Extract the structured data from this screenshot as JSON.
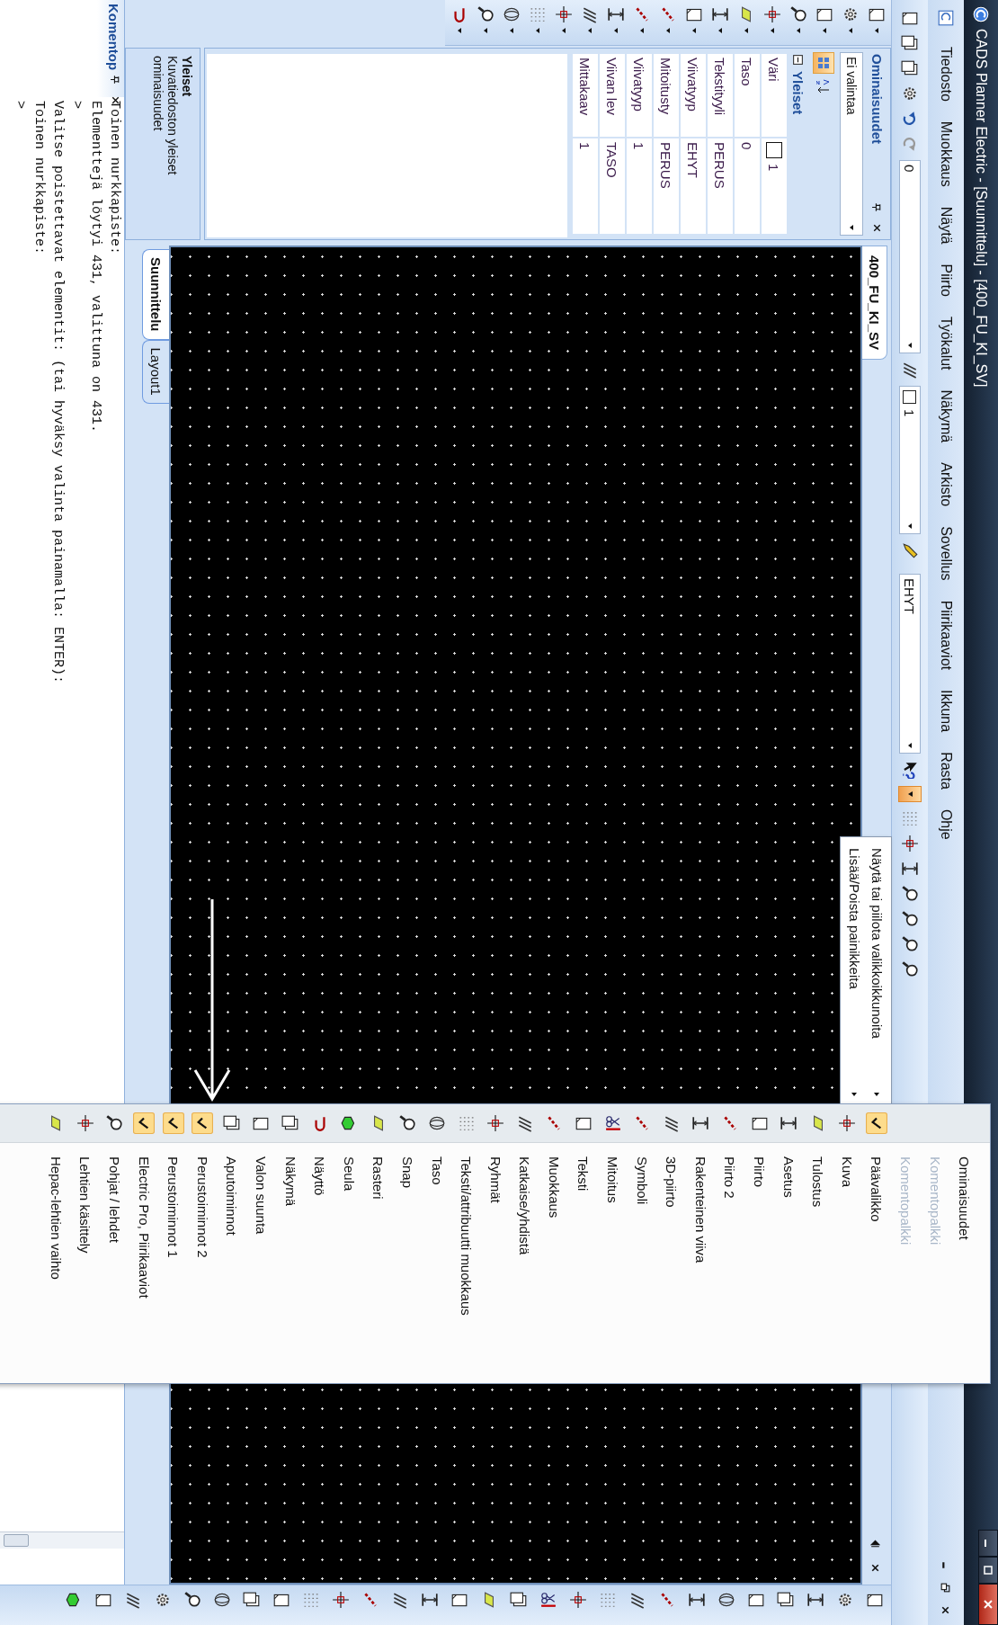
{
  "window": {
    "title": "CADS Planner Electric - [Suunnittelu] - [400_FU_KI_SV]"
  },
  "menu_bar": {
    "items": [
      "Tiedosto",
      "Muokkaus",
      "Näytä",
      "Piirto",
      "Työkalut",
      "Näkymä",
      "Arkisto",
      "Sovellus",
      "Piirikaaviot",
      "Ikkuna",
      "Rasta",
      "Ohje"
    ]
  },
  "toolbar": {
    "layer_combo": "0",
    "color_combo": "1",
    "linetype_combo": "EHYT",
    "overflow_button": {
      "expanded": true
    }
  },
  "properties_panel": {
    "title": "Ominaisuudet",
    "selection": "Ei valintaa",
    "sort_buttons": [
      {
        "kind": "categorized",
        "selected": true
      },
      {
        "kind": "alphabetical",
        "selected": false
      }
    ],
    "section": {
      "title": "Yleiset",
      "expanded": true
    },
    "rows": [
      {
        "kind": "color",
        "label": "Väri",
        "value": "1"
      },
      {
        "kind": "text",
        "label": "Taso",
        "value": "0"
      },
      {
        "kind": "text",
        "label": "Tekstityyli",
        "value": "PERUS"
      },
      {
        "kind": "text",
        "label": "Viivatyyp",
        "value": "EHYT"
      },
      {
        "kind": "text",
        "label": "Mitoitusty",
        "value": "PERUS"
      },
      {
        "kind": "text",
        "label": "Viivatyyp",
        "value": "1"
      },
      {
        "kind": "text",
        "label": "Viivan lev",
        "value": "TASO"
      },
      {
        "kind": "text",
        "label": "Mittakaav",
        "value": "1"
      }
    ]
  },
  "description": {
    "title": "Yleiset",
    "text": "Kuvatiedoston yleiset ominaisuudet"
  },
  "document_tab": "400_FU_KI_SV",
  "sheet_tabs": [
    {
      "label": "Suunnittelu",
      "selected": true
    },
    {
      "label": "Layout1",
      "selected": false
    }
  ],
  "command_panel": {
    "title": "Komentop",
    "lines": [
      "Toinen nurkkapiste:",
      "Elementtejä löytyi 431, valittuna on 431.",
      ">",
      "Valitse poistettavat elementit: (tai hyväksy valinta painamalla: ENTER):",
      "Toinen nurkkapiste:",
      ">"
    ]
  },
  "submenu": {
    "items": [
      "Näytä tai piilota valikkoikkunoita",
      "Lisää/Poista painikkeita"
    ]
  },
  "toolbar_menu": {
    "items": [
      {
        "kind": "plain",
        "label": "Ominaisuudet",
        "checked": false,
        "disabled": false
      },
      {
        "kind": "plain",
        "label": "Komentopalkki",
        "checked": false,
        "disabled": true
      },
      {
        "kind": "plain",
        "label": "Komentopalkki",
        "checked": false,
        "disabled": true
      },
      {
        "kind": "tool",
        "label": "Päävalikko",
        "checked": true,
        "disabled": false
      },
      {
        "kind": "tool",
        "label": "Kuva",
        "checked": false,
        "disabled": false
      },
      {
        "kind": "tool",
        "label": "Tulostus",
        "checked": false,
        "disabled": false
      },
      {
        "kind": "tool",
        "label": "Asetus",
        "checked": false,
        "disabled": false
      },
      {
        "kind": "tool",
        "label": "Piirto",
        "checked": false,
        "disabled": false
      },
      {
        "kind": "tool",
        "label": "Piirto 2",
        "checked": false,
        "disabled": false
      },
      {
        "kind": "tool",
        "label": "Rakenteinen viiva",
        "checked": false,
        "disabled": false
      },
      {
        "kind": "tool",
        "label": "3D-piirto",
        "checked": false,
        "disabled": false
      },
      {
        "kind": "tool",
        "label": "Symboli",
        "checked": false,
        "disabled": false
      },
      {
        "kind": "tool",
        "label": "Mitoitus",
        "checked": false,
        "disabled": false
      },
      {
        "kind": "tool",
        "label": "Teksti",
        "checked": false,
        "disabled": false
      },
      {
        "kind": "tool",
        "label": "Muokkaus",
        "checked": false,
        "disabled": false
      },
      {
        "kind": "tool",
        "label": "Katkaise/yhdistä",
        "checked": false,
        "disabled": false
      },
      {
        "kind": "tool",
        "label": "Ryhmät",
        "checked": false,
        "disabled": false
      },
      {
        "kind": "tool",
        "label": "Teksti/attribuutti muokkaus",
        "checked": false,
        "disabled": false
      },
      {
        "kind": "tool",
        "label": "Taso",
        "checked": false,
        "disabled": false
      },
      {
        "kind": "tool",
        "label": "Snap",
        "checked": false,
        "disabled": false
      },
      {
        "kind": "tool",
        "label": "Rasteri",
        "checked": false,
        "disabled": false
      },
      {
        "kind": "tool",
        "label": "Seula",
        "checked": false,
        "disabled": false
      },
      {
        "kind": "tool",
        "label": "Näyttö",
        "checked": false,
        "disabled": false
      },
      {
        "kind": "tool",
        "label": "Näkymä",
        "checked": false,
        "disabled": false
      },
      {
        "kind": "tool",
        "label": "Valon suunta",
        "checked": false,
        "disabled": false
      },
      {
        "kind": "tool",
        "label": "Aputoiminnot",
        "checked": false,
        "disabled": false
      },
      {
        "kind": "tool",
        "label": "Perustoiminnot 2",
        "checked": true,
        "disabled": false
      },
      {
        "kind": "tool",
        "label": "Perustoiminnot 1",
        "checked": true,
        "disabled": false
      },
      {
        "kind": "tool",
        "label": "Electric Pro, Piirikaaviot",
        "checked": true,
        "disabled": false
      },
      {
        "kind": "tool",
        "label": "Pohjat / lehdet",
        "checked": false,
        "disabled": false
      },
      {
        "kind": "tool",
        "label": "Lehtien käsittely",
        "checked": false,
        "disabled": false
      },
      {
        "kind": "tool",
        "label": "Hepac-lehtien vaihto",
        "checked": false,
        "disabled": false
      }
    ]
  }
}
